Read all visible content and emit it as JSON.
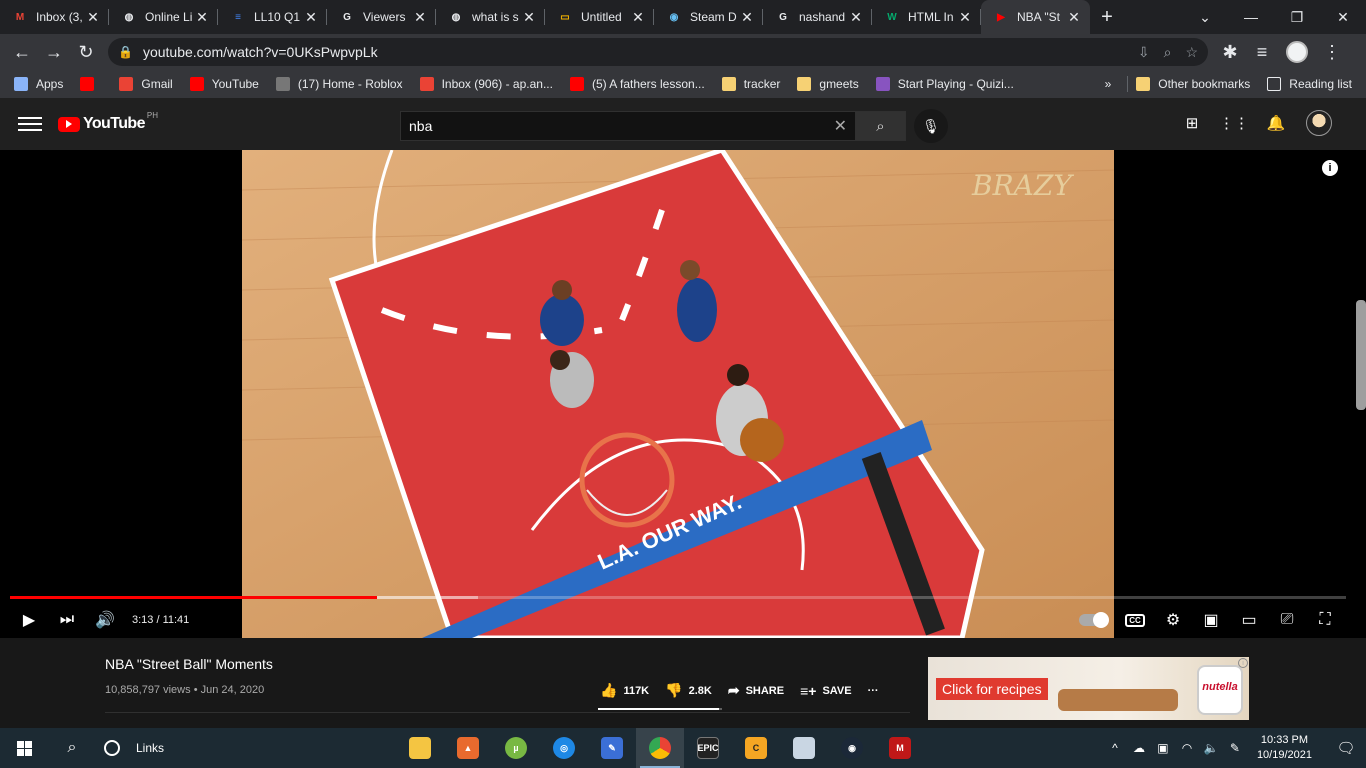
{
  "browser": {
    "tabs": [
      {
        "title": "Inbox (3,",
        "icon": "gmail-icon",
        "color": "#ea4335",
        "glyph": "M"
      },
      {
        "title": "Online Li",
        "icon": "globe-icon",
        "color": "#e8eaed",
        "glyph": "◍"
      },
      {
        "title": "LL10 Q1",
        "icon": "docs-icon",
        "color": "#4285f4",
        "glyph": "≡"
      },
      {
        "title": "Viewers",
        "icon": "google-icon",
        "color": "#e8eaed",
        "glyph": "G"
      },
      {
        "title": "what is s",
        "icon": "globe-icon",
        "color": "#e8eaed",
        "glyph": "◍"
      },
      {
        "title": "Untitled",
        "icon": "slides-icon",
        "color": "#f4b400",
        "glyph": "▭"
      },
      {
        "title": "Steam D",
        "icon": "steam-icon",
        "color": "#66c0f4",
        "glyph": "◉"
      },
      {
        "title": "nashand",
        "icon": "google-icon",
        "color": "#e8eaed",
        "glyph": "G"
      },
      {
        "title": "HTML In",
        "icon": "w3schools-icon",
        "color": "#04aa6d",
        "glyph": "W"
      },
      {
        "title": "NBA \"St",
        "icon": "youtube-icon",
        "color": "#ff0000",
        "glyph": "▶",
        "active": true
      }
    ],
    "new_tab": "+",
    "url": "youtube.com/watch?v=0UKsPwpvpLk",
    "bookmarks": [
      {
        "label": "Apps",
        "icon": "apps-grid-icon"
      },
      {
        "label": "",
        "icon": "youtube-icon"
      },
      {
        "label": "Gmail",
        "icon": "gmail-icon"
      },
      {
        "label": "YouTube",
        "icon": "youtube-icon"
      },
      {
        "label": "(17) Home - Roblox",
        "icon": "roblox-icon"
      },
      {
        "label": "Inbox (906) - ap.an...",
        "icon": "gmail-icon"
      },
      {
        "label": "(5) A fathers lesson...",
        "icon": "youtube-icon"
      },
      {
        "label": "tracker",
        "icon": "folder-icon"
      },
      {
        "label": "gmeets",
        "icon": "folder-icon"
      },
      {
        "label": "Start Playing - Quizi...",
        "icon": "quizizz-icon"
      }
    ],
    "bookmarks_overflow": "»",
    "other_bookmarks": "Other bookmarks",
    "reading_list": "Reading list"
  },
  "youtube": {
    "logo_text": "YouTube",
    "country_code": "PH",
    "search_value": "nba",
    "video": {
      "title": "NBA \"Street Ball\" Moments",
      "views": "10,858,797 views",
      "date": "Jun 24, 2020",
      "time_display": "3:13 / 11:41",
      "progress": 0.275,
      "buffered": 0.35,
      "watermark": "BRAZY",
      "court_banner": "L.A. OUR WAY."
    },
    "actions": {
      "likes": "117K",
      "dislikes": "2.8K",
      "share": "SHARE",
      "save": "SAVE",
      "like_ratio": 0.977
    },
    "ad": {
      "cta": "Click for recipes",
      "brand": "nutella"
    }
  },
  "taskbar": {
    "links_label": "Links",
    "time": "10:33 PM",
    "date": "10/19/2021"
  },
  "colors": {
    "yt_red": "#ff0000",
    "court_red": "#d93a3a",
    "court_wood": "#d4a373",
    "clippers_blue": "#1d428a",
    "taskbar": "#1c2a33"
  }
}
